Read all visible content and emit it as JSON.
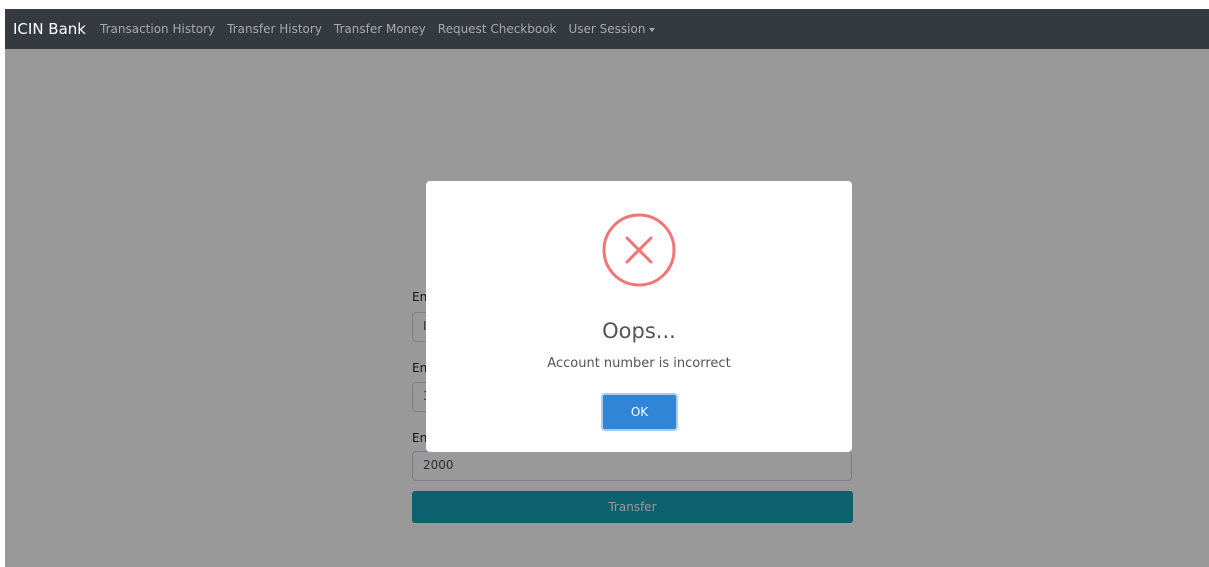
{
  "navbar": {
    "brand": "ICIN Bank",
    "links": [
      "Transaction History",
      "Transfer History",
      "Transfer Money",
      "Request Checkbook"
    ],
    "user_session_label": "User Session"
  },
  "form": {
    "fields": [
      {
        "label": "En",
        "value": "I"
      },
      {
        "label": "En",
        "value": "3"
      },
      {
        "label": "En",
        "value": "2000"
      }
    ],
    "submit_label": "Transfer"
  },
  "dialog": {
    "icon": "error-x-icon",
    "title": "Oops...",
    "message": "Account number is incorrect",
    "confirm_label": "OK"
  },
  "colors": {
    "navbar": "#343a40",
    "transfer_button": "#17a2b8",
    "ok_button": "#3085d6",
    "error_icon": "#f27474"
  }
}
